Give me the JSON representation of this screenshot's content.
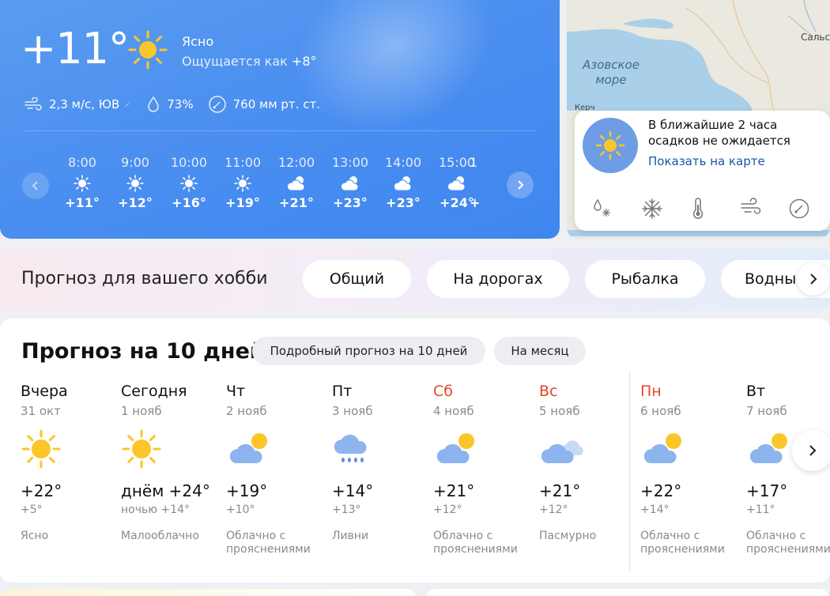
{
  "current": {
    "temp": "+11°",
    "condition": "Ясно",
    "feels_prefix": "Ощущается как",
    "feels_value": "+8°",
    "wind": "2,3 м/с, ЮВ",
    "humidity": "73%",
    "pressure": "760 мм рт. ст."
  },
  "hourly": [
    {
      "time": "8:00",
      "icon": "sun-icon",
      "temp": "+11°"
    },
    {
      "time": "9:00",
      "icon": "sun-icon",
      "temp": "+12°"
    },
    {
      "time": "10:00",
      "icon": "sun-icon",
      "temp": "+16°"
    },
    {
      "time": "11:00",
      "icon": "sun-icon",
      "temp": "+19°"
    },
    {
      "time": "12:00",
      "icon": "sun-cloud-icon",
      "temp": "+21°"
    },
    {
      "time": "13:00",
      "icon": "sun-cloud-icon",
      "temp": "+23°"
    },
    {
      "time": "14:00",
      "icon": "sun-cloud-icon",
      "temp": "+23°"
    },
    {
      "time": "15:00",
      "icon": "sun-cloud-icon",
      "temp": "+24°"
    },
    {
      "time": "1",
      "icon": "",
      "temp": "+"
    }
  ],
  "map": {
    "sea_label_1": "Азовское",
    "sea_label_2": "море",
    "city_label": "Сальс",
    "small_label": "Керч",
    "precip_message": "В ближайшие 2 часа осадков не ожидается",
    "show_on_map": "Показать на карте",
    "layers": [
      "precip-icon",
      "snowflake-icon",
      "thermometer-icon",
      "wind-icon",
      "pressure-icon"
    ]
  },
  "hobby": {
    "title": "Прогноз для вашего хобби",
    "chips": [
      "Общий",
      "На дорогах",
      "Рыбалка",
      "Водны"
    ]
  },
  "forecast": {
    "title": "Прогноз на 10 дней",
    "detailed_button": "Подробный прогноз на 10 дней",
    "month_button": "На месяц",
    "days": [
      {
        "name": "Вчера",
        "date": "31 окт",
        "icon": "sun-icon",
        "hi": "+22°",
        "lo": "+5°",
        "desc": "Ясно",
        "weekend": false
      },
      {
        "name": "Сегодня",
        "date": "1 нояб",
        "icon": "sun-icon",
        "hi": "днём +24°",
        "lo": "ночью +14°",
        "desc": "Малооблачно",
        "weekend": false
      },
      {
        "name": "Чт",
        "date": "2 нояб",
        "icon": "cloud-sun-icon",
        "hi": "+19°",
        "lo": "+10°",
        "desc": "Облачно с прояснениями",
        "weekend": false
      },
      {
        "name": "Пт",
        "date": "3 нояб",
        "icon": "rain-icon",
        "hi": "+14°",
        "lo": "+13°",
        "desc": "Ливни",
        "weekend": false
      },
      {
        "name": "Сб",
        "date": "4 нояб",
        "icon": "cloud-sun-icon",
        "hi": "+21°",
        "lo": "+12°",
        "desc": "Облачно с прояснениями",
        "weekend": true
      },
      {
        "name": "Вс",
        "date": "5 нояб",
        "icon": "overcast-icon",
        "hi": "+21°",
        "lo": "+12°",
        "desc": "Пасмурно",
        "weekend": true
      },
      {
        "name": "Пн",
        "date": "6 нояб",
        "icon": "cloud-sun-icon",
        "hi": "+22°",
        "lo": "+14°",
        "desc": "Облачно с прояснениями",
        "weekend": true
      },
      {
        "name": "Вт",
        "date": "7 нояб",
        "icon": "cloud-sun-icon",
        "hi": "+17°",
        "lo": "+11°",
        "desc": "Облачно с прояснениями",
        "weekend": false
      }
    ]
  },
  "colors": {
    "accent_blue": "#4b8ff0",
    "weekend_red": "#e5452b",
    "link_blue": "#1a56a8",
    "sun_yellow": "#fbc62a"
  }
}
